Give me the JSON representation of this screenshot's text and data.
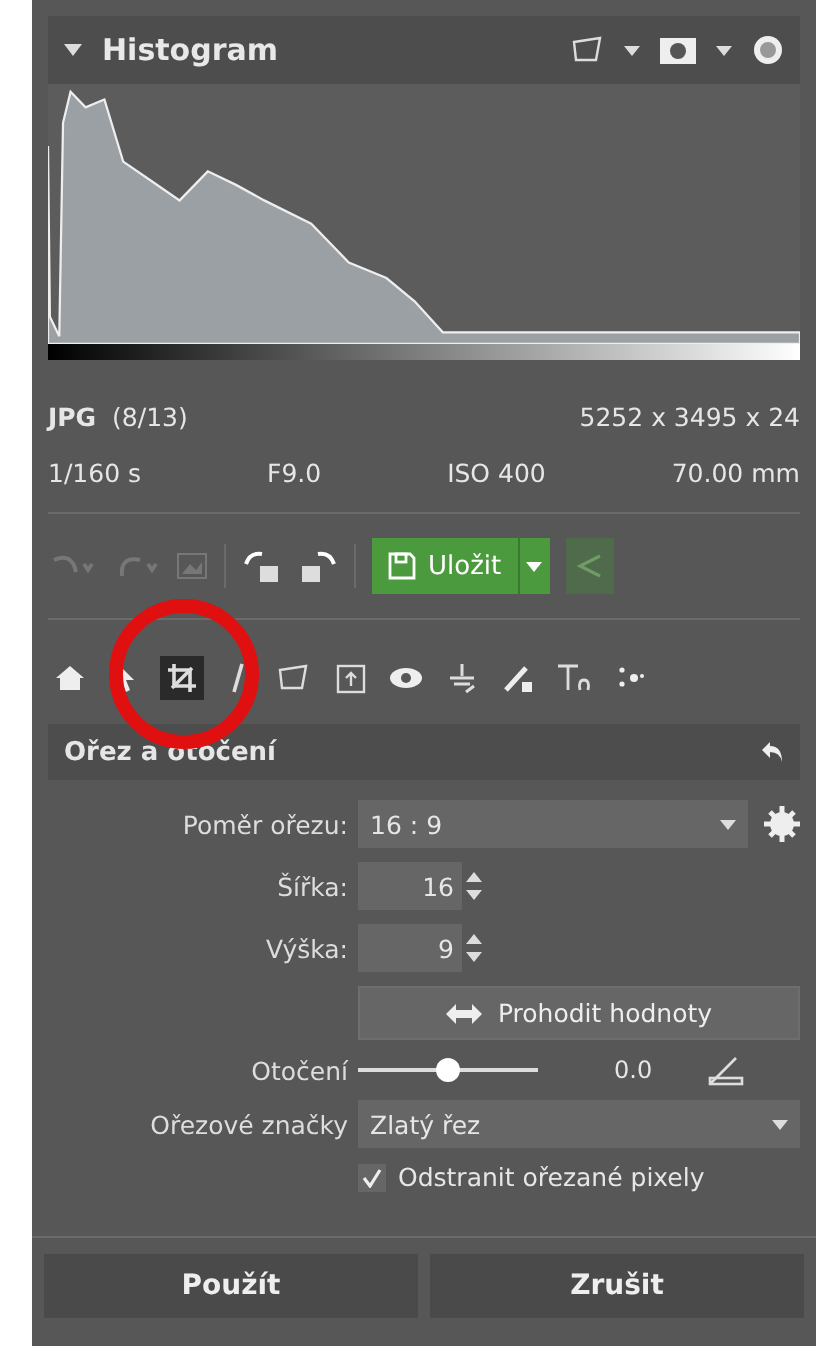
{
  "histogram": {
    "title": "Histogram",
    "expanded": true
  },
  "info": {
    "format": "JPG",
    "index": "(8/13)",
    "dimensions": "5252 x 3495 x 24",
    "shutter": "1/160 s",
    "aperture": "F9.0",
    "iso": "ISO 400",
    "focal": "70.00 mm"
  },
  "toolbar": {
    "save_label": "Uložit"
  },
  "tools": [
    {
      "kind": "home",
      "selected": false
    },
    {
      "kind": "pointer",
      "selected": false
    },
    {
      "kind": "crop",
      "selected": true
    },
    {
      "kind": "straighten",
      "selected": false
    },
    {
      "kind": "selection",
      "selected": false
    },
    {
      "kind": "frame",
      "selected": false
    },
    {
      "kind": "eye",
      "selected": false
    },
    {
      "kind": "stamp",
      "selected": false
    },
    {
      "kind": "brush",
      "selected": false
    },
    {
      "kind": "text",
      "selected": false
    },
    {
      "kind": "effects",
      "selected": false
    }
  ],
  "section": {
    "title": "Ořez a otočení"
  },
  "crop": {
    "ratio_label": "Poměr ořezu:",
    "ratio_value": "16 : 9",
    "width_label": "Šířka:",
    "width_value": "16",
    "height_label": "Výška:",
    "height_value": "9",
    "swap_button": "Prohodit hodnoty",
    "rotation_label": "Otočení",
    "rotation": {
      "level": 0.5
    },
    "rotation_value": "0.0",
    "guides_label": "Ořezové značky",
    "guides_value": "Zlatý řez",
    "remove_pixels": {
      "label": "Odstranit ořezané pixely",
      "checked": true
    }
  },
  "buttons": [
    {
      "label": "Použít"
    },
    {
      "label": "Zrušit"
    }
  ]
}
